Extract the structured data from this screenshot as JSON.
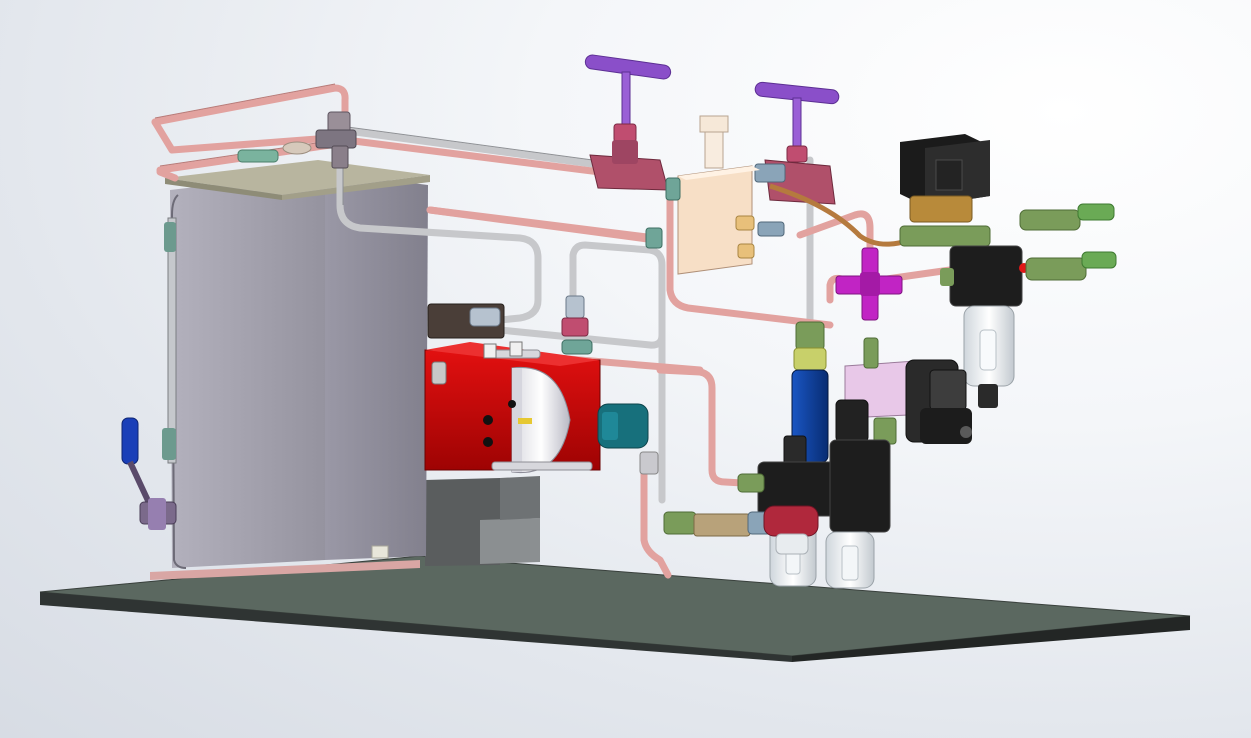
{
  "scene": {
    "subject": "cad-3d-assembly-render",
    "view": "isometric-shaded",
    "labels": []
  },
  "colors": {
    "background_light": "#f4f6f9",
    "background_dark": "#d7dce4",
    "base_plate_top": "#5b6860",
    "base_plate_bottom": "#2a2e2d",
    "tank_front": "#8e8c98",
    "tank_side": "#a3a1ad",
    "tank_top": "#c7c4cd",
    "copper_tube": "#e2a29f",
    "steel_tube": "#c7c8cb",
    "pink_fitting": "#b0506a",
    "purple_handle": "#8a4fc9",
    "magenta_cross": "#c124c4",
    "red_pump": "#c20606",
    "cream_block": "#f7dfc6",
    "solenoid_black": "#1b1b1b",
    "green_fitting": "#7a9c5a",
    "blue_valve": "#0b3f9c",
    "teal_motor": "#17707c",
    "filter_bowl": "#e8ecef",
    "stand_grey": "#5a5d5e"
  },
  "icons": [
    "needle-valve-handle-icon",
    "solenoid-valve-icon",
    "filter-regulator-icon",
    "ball-valve-icon",
    "hose-barb-icon"
  ]
}
